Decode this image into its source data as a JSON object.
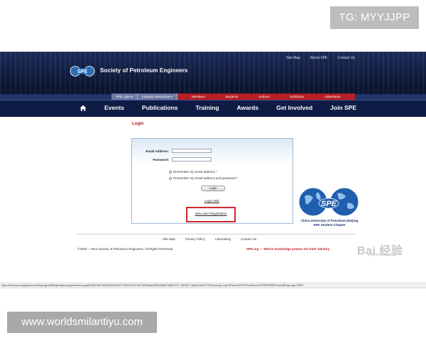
{
  "watermarks": {
    "tg": "TG: MYYJJPP",
    "site": "www.worldsmilantiyu.com",
    "baidu": "Bai 经验",
    "baidu_sub": "jingyan.baidu.com"
  },
  "header": {
    "org_name": "Society of Petroleum Engineers",
    "logo_text": "SPE",
    "top_links": [
      "Site Map",
      "About SPE",
      "Contact Us"
    ],
    "util_dropdowns": [
      "SPE Links ▾",
      "Industry Resources ▾"
    ],
    "util_links": [
      "Members",
      "Students",
      "Authors",
      "Exhibitors",
      "Advertisers"
    ],
    "nav": [
      "Events",
      "Publications",
      "Training",
      "Awards",
      "Get Involved",
      "Join SPE"
    ]
  },
  "login": {
    "title": "Login",
    "email_label": "Email Address:",
    "password_label": "Password:",
    "remember_email": "Remember my email address *",
    "remember_both": "Remember my email address and password *",
    "button": "Login",
    "help": "Login help",
    "new_user": "New User Registration"
  },
  "university": {
    "logo_text": "SPE",
    "caption": "China University of Petroleum,Beijing SPE Student Chapter"
  },
  "footer": {
    "links": [
      "Site Map",
      "Privacy Policy",
      "Advertising",
      "Contact Us"
    ],
    "copyright": "©2003 – 2014 Society of Petroleum Engineers, All Rights Reserved",
    "slogan": "SPE.org — Where knowledge powers the E&P industry"
  },
  "status_url": "https://www.spe.org/appssecured/login/jsp/siteRegistration.jsp;jsessionid=ypqd5mG8KHMTWhdSlnEN/A2G2TYW3Tmn0SYhHTWrb!8qaVKBB0356B2T0BIGHTS_TARGET=https%3A%2F%2Fwww.spe.org%2Fsms%2FSPEJoinRenew%2FSPEMBRPrecreditPage.aspx%3FM",
  "colors": {
    "brand_navy": "#0d1a3f",
    "brand_red": "#b61f24",
    "highlight_red": "#d0262c"
  }
}
